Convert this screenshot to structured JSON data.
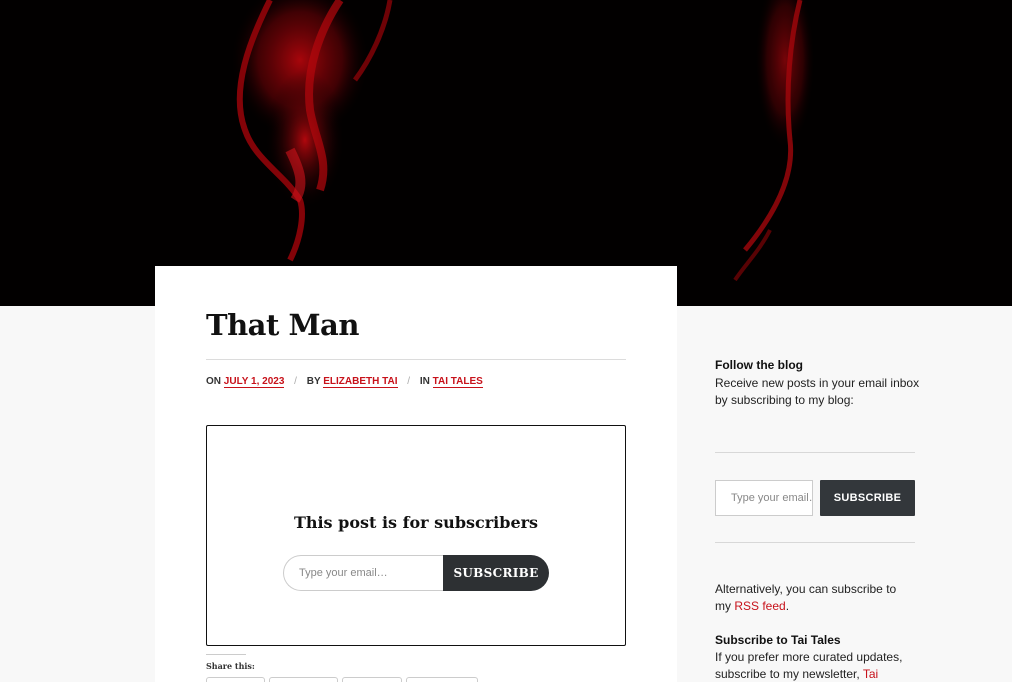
{
  "header": {
    "image": "dark-portrait-red-light-header-image"
  },
  "post": {
    "title": "That Man",
    "meta": {
      "on_prefix": "ON",
      "date": "JULY 1, 2023",
      "by_prefix": "BY",
      "author": "ELIZABETH TAI",
      "in_prefix": "IN",
      "category": "TAI TALES",
      "separator": "/"
    },
    "paywall": {
      "heading": "This post is for subscribers",
      "email_placeholder": "Type your email…",
      "subscribe_label": "SUBSCRIBE"
    },
    "share_label": "Share this:"
  },
  "sidebar": {
    "follow_title": "Follow the blog",
    "follow_text": "Receive new posts in your email inbox by subscribing to my blog:",
    "email_placeholder": "Type your email…",
    "subscribe_label": "SUBSCRIBE",
    "alt_text": "Alternatively, you can subscribe to my",
    "rss_link": "RSS feed",
    "rss_suffix": ".",
    "newsletter_title": "Subscribe to Tai Tales",
    "newsletter_text": "If you prefer more curated updates, subscribe to my newsletter,",
    "newsletter_link": "Tai Tales",
    "newsletter_suffix": "."
  },
  "colors": {
    "accent": "#c7111a",
    "button_dark": "#2d3033",
    "page_bg": "#f8f8f8"
  }
}
